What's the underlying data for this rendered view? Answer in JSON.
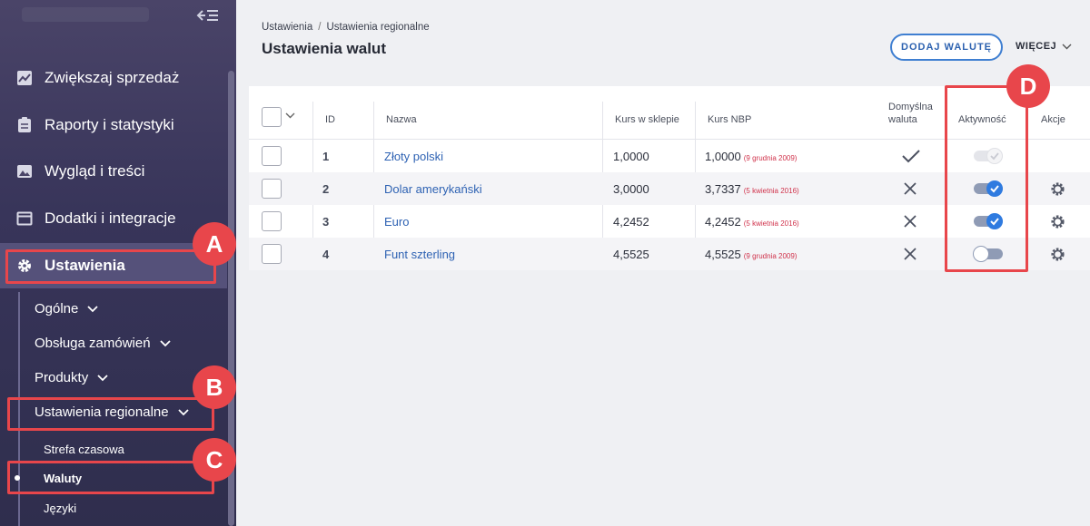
{
  "sidebar": {
    "menu": [
      {
        "label": "Zwiększaj sprzedaż",
        "icon": "chart-icon"
      },
      {
        "label": "Raporty i statystyki",
        "icon": "clipboard-icon"
      },
      {
        "label": "Wygląd i treści",
        "icon": "image-icon"
      },
      {
        "label": "Dodatki i integracje",
        "icon": "window-icon"
      },
      {
        "label": "Ustawienia",
        "icon": "gear-icon",
        "active": true
      }
    ],
    "submenu": [
      {
        "label": "Ogólne"
      },
      {
        "label": "Obsługa zamówień"
      },
      {
        "label": "Produkty"
      },
      {
        "label": "Ustawienia regionalne"
      }
    ],
    "subsubmenu": [
      {
        "label": "Strefa czasowa"
      },
      {
        "label": "Waluty",
        "active": true
      },
      {
        "label": "Języki"
      }
    ]
  },
  "callouts": {
    "a": "A",
    "b": "B",
    "c": "C",
    "d": "D"
  },
  "breadcrumb": {
    "root": "Ustawienia",
    "separator": "/",
    "current": "Ustawienia regionalne"
  },
  "page": {
    "title": "Ustawienia walut"
  },
  "toolbar": {
    "add_label": "DODAJ WALUTĘ",
    "more_label": "WIĘCEJ"
  },
  "table": {
    "headers": {
      "id": "ID",
      "name": "Nazwa",
      "shop_rate": "Kurs w sklepie",
      "nbp_rate": "Kurs NBP",
      "default_line1": "Domyślna",
      "default_line2": "waluta",
      "active": "Aktywność",
      "actions": "Akcje"
    },
    "rows": [
      {
        "id": "1",
        "name": "Złoty polski",
        "shop_rate": "1,0000",
        "nbp_rate": "1,0000",
        "nbp_date": "(9 grudnia 2009)",
        "is_default": true,
        "active": true,
        "active_locked": true,
        "has_actions": false
      },
      {
        "id": "2",
        "name": "Dolar amerykański",
        "shop_rate": "3,0000",
        "nbp_rate": "3,7337",
        "nbp_date": "(5 kwietnia 2016)",
        "is_default": false,
        "active": true,
        "active_locked": false,
        "has_actions": true
      },
      {
        "id": "3",
        "name": "Euro",
        "shop_rate": "4,2452",
        "nbp_rate": "4,2452",
        "nbp_date": "(5 kwietnia 2016)",
        "is_default": false,
        "active": true,
        "active_locked": false,
        "has_actions": true
      },
      {
        "id": "4",
        "name": "Funt szterling",
        "shop_rate": "4,5525",
        "nbp_rate": "4,5525",
        "nbp_date": "(9 grudnia 2009)",
        "is_default": false,
        "active": false,
        "active_locked": false,
        "has_actions": true
      }
    ]
  },
  "colors": {
    "accent": "#3f7fd1",
    "callout": "#e8464b",
    "date": "#d0324b",
    "sidebar": "#38355a"
  }
}
